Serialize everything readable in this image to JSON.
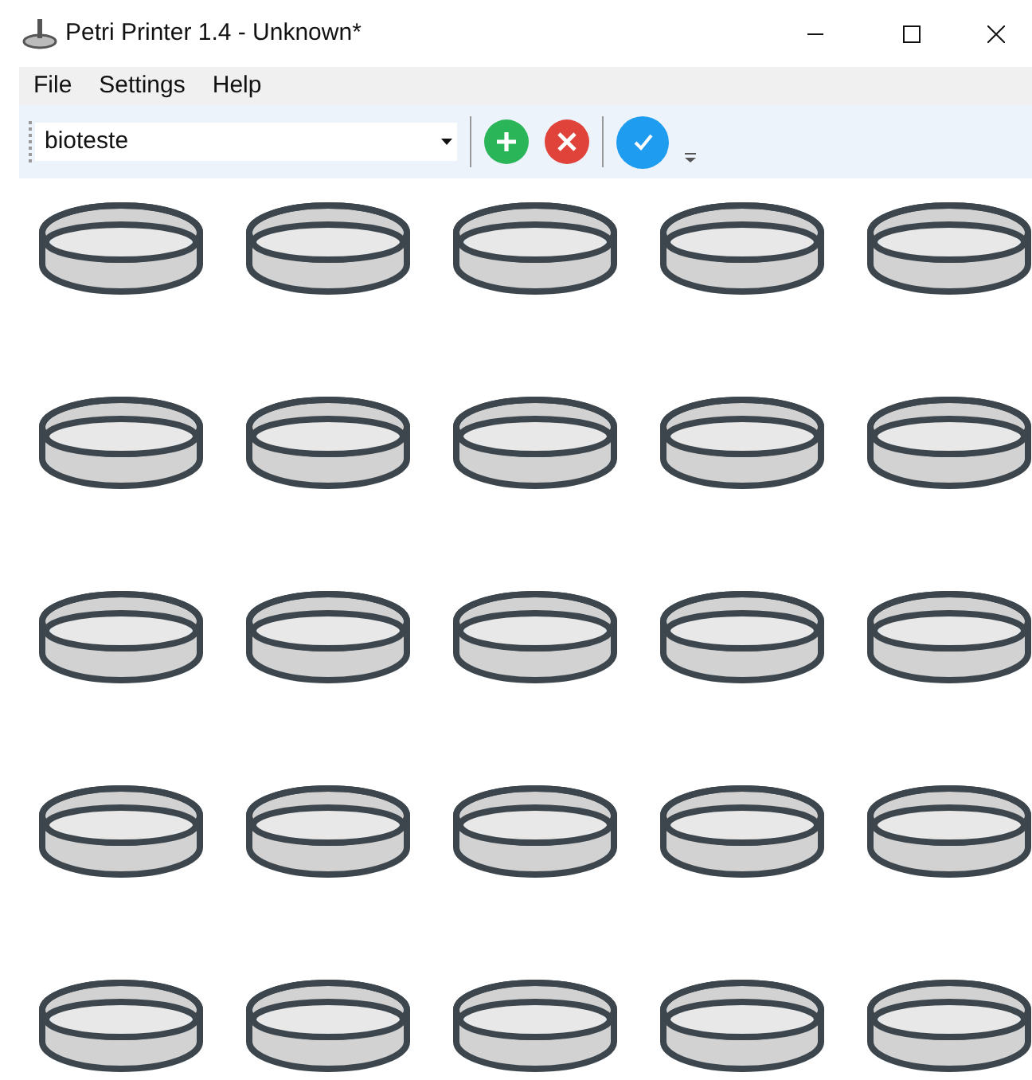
{
  "window": {
    "title": "Petri Printer 1.4 - Unknown*"
  },
  "menu": [
    {
      "label": "File"
    },
    {
      "label": "Settings"
    },
    {
      "label": "Help"
    }
  ],
  "toolbar": {
    "profile": {
      "value": "bioteste"
    },
    "buttons": [
      {
        "kind": "add"
      },
      {
        "kind": "remove"
      },
      {
        "kind": "confirm"
      }
    ]
  },
  "dishes": [
    {
      "kind": "dish"
    },
    {
      "kind": "dish"
    },
    {
      "kind": "dish"
    },
    {
      "kind": "dish"
    },
    {
      "kind": "dish"
    },
    {
      "kind": "dish"
    },
    {
      "kind": "dish"
    },
    {
      "kind": "dish"
    },
    {
      "kind": "dish"
    },
    {
      "kind": "dish"
    },
    {
      "kind": "dish"
    },
    {
      "kind": "dish"
    },
    {
      "kind": "dish"
    },
    {
      "kind": "dish"
    },
    {
      "kind": "dish"
    },
    {
      "kind": "dish"
    },
    {
      "kind": "dish"
    },
    {
      "kind": "dish"
    },
    {
      "kind": "dish"
    },
    {
      "kind": "dish"
    },
    {
      "kind": "dish"
    },
    {
      "kind": "dish"
    },
    {
      "kind": "dish"
    },
    {
      "kind": "dish"
    },
    {
      "kind": "dish"
    }
  ]
}
